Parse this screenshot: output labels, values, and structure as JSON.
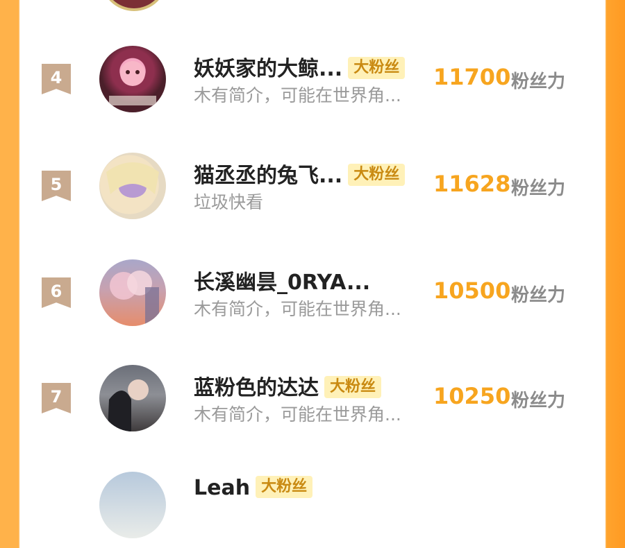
{
  "rows": [
    {
      "rank": "4",
      "name": "妖妖家的大鲸...",
      "badge": "大粉丝",
      "bio": "木有简介，可能在世界角...",
      "score": "11700",
      "unit": "粉丝力",
      "avatar": "avatar-pink-character"
    },
    {
      "rank": "5",
      "name": "猫丞丞的兔飞...",
      "badge": "大粉丝",
      "bio": "垃圾快看",
      "score": "11628",
      "unit": "粉丝力",
      "avatar": "avatar-blonde-masked"
    },
    {
      "rank": "6",
      "name": "长溪幽昙_0RYA...",
      "badge": "",
      "bio": "木有简介，可能在世界角...",
      "score": "10500",
      "unit": "粉丝力",
      "avatar": "avatar-flower-tree"
    },
    {
      "rank": "7",
      "name": "蓝粉色的达达",
      "badge": "大粉丝",
      "bio": "木有简介，可能在世界角...",
      "score": "10250",
      "unit": "粉丝力",
      "avatar": "avatar-couple"
    }
  ],
  "partial_row": {
    "name": "Leah",
    "badge": "大粉丝"
  },
  "colors": {
    "accent": "#f7a51f",
    "rank_bg": "#c9aa8f",
    "badge_bg": "#fff1b8",
    "frame": "#ffa42e"
  }
}
